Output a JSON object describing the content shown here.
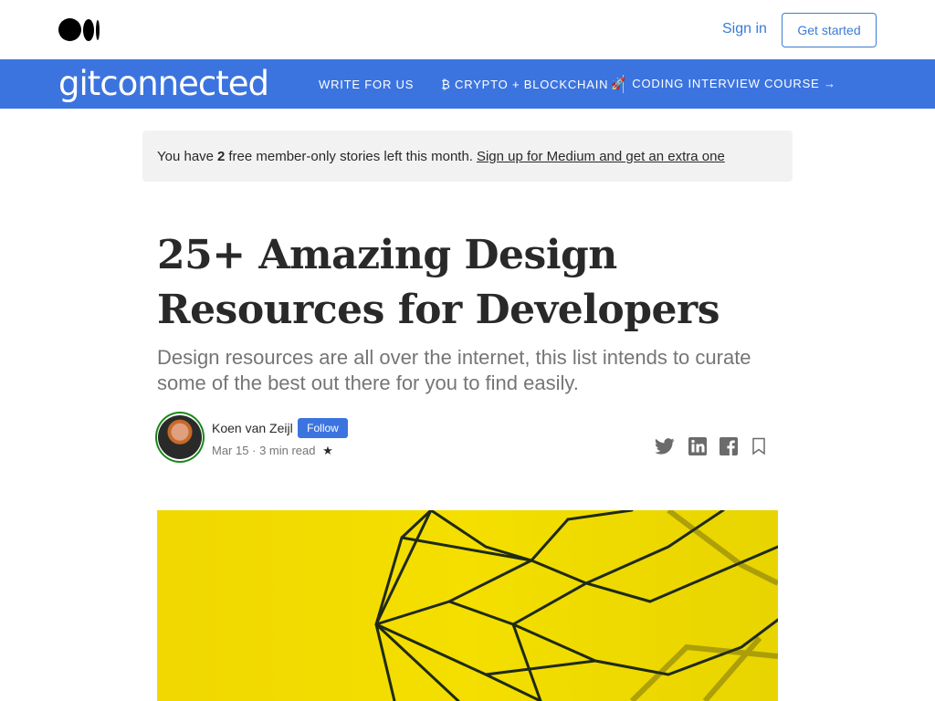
{
  "topbar": {
    "logo_icon": "medium-logo-icon",
    "signin_label": "Sign in",
    "get_started_label": "Get started",
    "accent_color": "#3a7bd5"
  },
  "publication": {
    "name": "gitconnected",
    "bar_color": "#3c74df",
    "nav": [
      {
        "label": "WRITE FOR US"
      },
      {
        "label": "₿ CRYPTO + BLOCKCHAIN"
      },
      {
        "label": "CODING INTERVIEW COURSE →",
        "icon": "rocket-icon",
        "icon_glyph": "🚀"
      }
    ]
  },
  "banner": {
    "prefix": "You have",
    "count": "2",
    "suffix": "free member-only stories left this month.",
    "link": "Sign up for Medium and get an extra one"
  },
  "article": {
    "title": "25+ Amazing Design Resources for Developers",
    "subtitle": "Design resources are all over the internet, this list intends to curate some of the best out there for you to find easily.",
    "author": {
      "name": "Koen van Zeijl",
      "follow_label": "Follow",
      "date": "Mar 15",
      "separator": "·",
      "read_time": "3 min read",
      "member_star": "★"
    },
    "share_icons": [
      "twitter-icon",
      "linkedin-icon",
      "facebook-icon",
      "bookmark-icon"
    ],
    "hero_colors": {
      "background": "#f0d800",
      "lines": "#1f2a14"
    }
  }
}
